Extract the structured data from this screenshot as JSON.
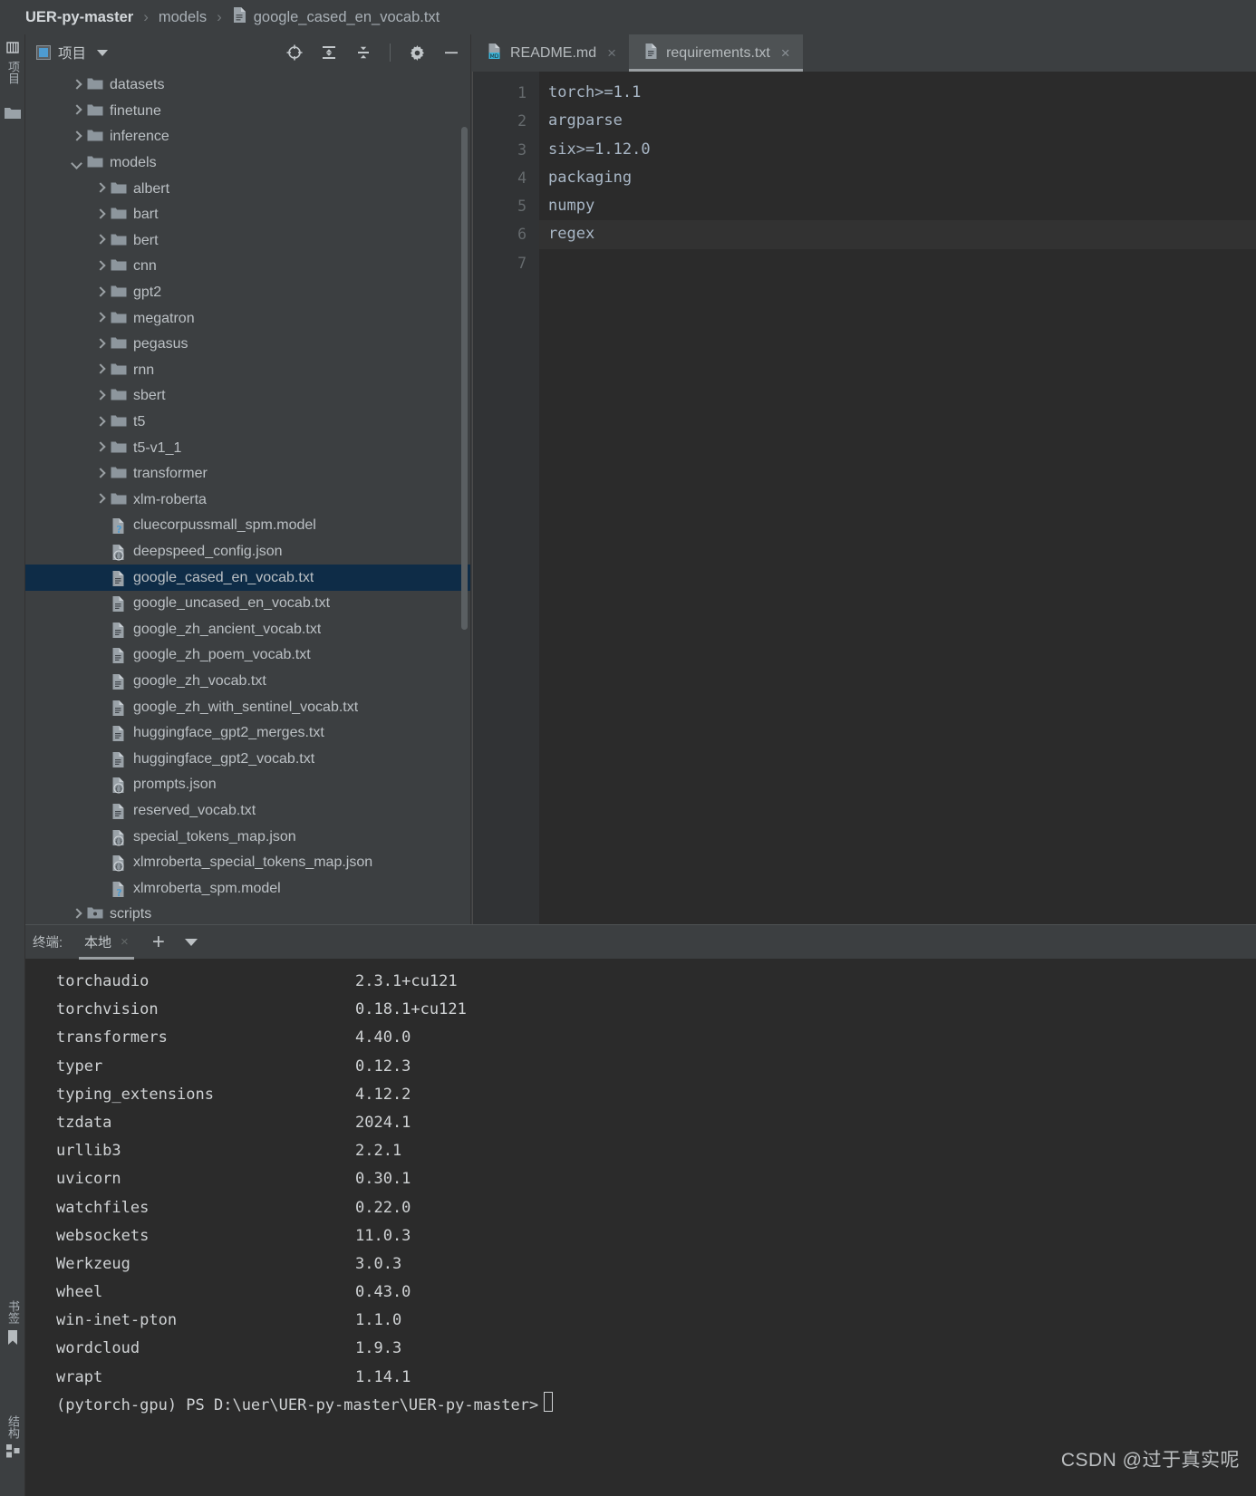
{
  "breadcrumb": {
    "root": "UER-py-master",
    "sep": "›",
    "middle": "models",
    "file": "google_cased_en_vocab.txt",
    "file_icon": "txt-file-icon"
  },
  "left_bar": {
    "top": [
      {
        "label": "项目",
        "icon": "project-icon"
      },
      {
        "label": "",
        "icon": "folder-icon"
      }
    ],
    "bottom": [
      {
        "label": "书签",
        "icon": "bookmark-icon"
      },
      {
        "label": "结构",
        "icon": "structure-icon"
      }
    ]
  },
  "project_panel": {
    "title": "项目",
    "title_icon": "project-window-icon",
    "caret_icon": "chevron-down-icon",
    "tools": [
      {
        "name": "locate-icon",
        "title": "Select Opened File"
      },
      {
        "name": "expand-all-icon",
        "title": "Expand All"
      },
      {
        "name": "collapse-all-icon",
        "title": "Collapse All"
      },
      {
        "name": "gear-icon",
        "title": "Settings"
      },
      {
        "name": "minimize-icon",
        "title": "Hide"
      }
    ],
    "tree": [
      {
        "label": "datasets",
        "indent": 1,
        "arrow": "closed",
        "icon": "folder",
        "selected": false
      },
      {
        "label": "finetune",
        "indent": 1,
        "arrow": "closed",
        "icon": "folder",
        "selected": false
      },
      {
        "label": "inference",
        "indent": 1,
        "arrow": "closed",
        "icon": "folder",
        "selected": false
      },
      {
        "label": "models",
        "indent": 1,
        "arrow": "open",
        "icon": "folder",
        "selected": false
      },
      {
        "label": "albert",
        "indent": 2,
        "arrow": "closed",
        "icon": "folder",
        "selected": false
      },
      {
        "label": "bart",
        "indent": 2,
        "arrow": "closed",
        "icon": "folder",
        "selected": false
      },
      {
        "label": "bert",
        "indent": 2,
        "arrow": "closed",
        "icon": "folder",
        "selected": false
      },
      {
        "label": "cnn",
        "indent": 2,
        "arrow": "closed",
        "icon": "folder",
        "selected": false
      },
      {
        "label": "gpt2",
        "indent": 2,
        "arrow": "closed",
        "icon": "folder",
        "selected": false
      },
      {
        "label": "megatron",
        "indent": 2,
        "arrow": "closed",
        "icon": "folder",
        "selected": false
      },
      {
        "label": "pegasus",
        "indent": 2,
        "arrow": "closed",
        "icon": "folder",
        "selected": false
      },
      {
        "label": "rnn",
        "indent": 2,
        "arrow": "closed",
        "icon": "folder",
        "selected": false
      },
      {
        "label": "sbert",
        "indent": 2,
        "arrow": "closed",
        "icon": "folder",
        "selected": false
      },
      {
        "label": "t5",
        "indent": 2,
        "arrow": "closed",
        "icon": "folder",
        "selected": false
      },
      {
        "label": "t5-v1_1",
        "indent": 2,
        "arrow": "closed",
        "icon": "folder",
        "selected": false
      },
      {
        "label": "transformer",
        "indent": 2,
        "arrow": "closed",
        "icon": "folder",
        "selected": false
      },
      {
        "label": "xlm-roberta",
        "indent": 2,
        "arrow": "closed",
        "icon": "folder",
        "selected": false
      },
      {
        "label": "cluecorpussmall_spm.model",
        "indent": 2,
        "arrow": "none",
        "icon": "unknown-file",
        "selected": false
      },
      {
        "label": "deepspeed_config.json",
        "indent": 2,
        "arrow": "none",
        "icon": "json-file",
        "selected": false
      },
      {
        "label": "google_cased_en_vocab.txt",
        "indent": 2,
        "arrow": "none",
        "icon": "txt-file",
        "selected": true
      },
      {
        "label": "google_uncased_en_vocab.txt",
        "indent": 2,
        "arrow": "none",
        "icon": "txt-file",
        "selected": false
      },
      {
        "label": "google_zh_ancient_vocab.txt",
        "indent": 2,
        "arrow": "none",
        "icon": "txt-file",
        "selected": false
      },
      {
        "label": "google_zh_poem_vocab.txt",
        "indent": 2,
        "arrow": "none",
        "icon": "txt-file",
        "selected": false
      },
      {
        "label": "google_zh_vocab.txt",
        "indent": 2,
        "arrow": "none",
        "icon": "txt-file",
        "selected": false
      },
      {
        "label": "google_zh_with_sentinel_vocab.txt",
        "indent": 2,
        "arrow": "none",
        "icon": "txt-file",
        "selected": false
      },
      {
        "label": "huggingface_gpt2_merges.txt",
        "indent": 2,
        "arrow": "none",
        "icon": "txt-file",
        "selected": false
      },
      {
        "label": "huggingface_gpt2_vocab.txt",
        "indent": 2,
        "arrow": "none",
        "icon": "txt-file",
        "selected": false
      },
      {
        "label": "prompts.json",
        "indent": 2,
        "arrow": "none",
        "icon": "json-file",
        "selected": false
      },
      {
        "label": "reserved_vocab.txt",
        "indent": 2,
        "arrow": "none",
        "icon": "txt-file",
        "selected": false
      },
      {
        "label": "special_tokens_map.json",
        "indent": 2,
        "arrow": "none",
        "icon": "json-file",
        "selected": false
      },
      {
        "label": "xlmroberta_special_tokens_map.json",
        "indent": 2,
        "arrow": "none",
        "icon": "json-file",
        "selected": false
      },
      {
        "label": "xlmroberta_spm.model",
        "indent": 2,
        "arrow": "none",
        "icon": "unknown-file",
        "selected": false
      },
      {
        "label": "scripts",
        "indent": 1,
        "arrow": "closed",
        "icon": "source-folder",
        "selected": false
      }
    ]
  },
  "editor": {
    "tabs": [
      {
        "label": "README.md",
        "icon": "md-file-icon",
        "active": false,
        "close": "×"
      },
      {
        "label": "requirements.txt",
        "icon": "txt-file-icon",
        "active": true,
        "close": "×"
      }
    ],
    "line_numbers": [
      "1",
      "2",
      "3",
      "4",
      "5",
      "6",
      "7"
    ],
    "lines": [
      {
        "text": "torch>=1.1",
        "current": false
      },
      {
        "text": "argparse",
        "current": false
      },
      {
        "text": "six>=1.12.0",
        "current": false
      },
      {
        "text": "packaging",
        "current": false
      },
      {
        "text": "numpy",
        "current": false
      },
      {
        "text": "regex",
        "current": true
      },
      {
        "text": "",
        "current": false
      }
    ]
  },
  "terminal": {
    "label": "终端:",
    "tab": "本地",
    "tab_close": "×",
    "add_icon": "plus-icon",
    "dropdown_icon": "chevron-down-icon",
    "packages": [
      {
        "name": "torchaudio",
        "version": "2.3.1+cu121"
      },
      {
        "name": "torchvision",
        "version": "0.18.1+cu121"
      },
      {
        "name": "transformers",
        "version": "4.40.0"
      },
      {
        "name": "typer",
        "version": "0.12.3"
      },
      {
        "name": "typing_extensions",
        "version": "4.12.2"
      },
      {
        "name": "tzdata",
        "version": "2024.1"
      },
      {
        "name": "urllib3",
        "version": "2.2.1"
      },
      {
        "name": "uvicorn",
        "version": "0.30.1"
      },
      {
        "name": "watchfiles",
        "version": "0.22.0"
      },
      {
        "name": "websockets",
        "version": "11.0.3"
      },
      {
        "name": "Werkzeug",
        "version": "3.0.3"
      },
      {
        "name": "wheel",
        "version": "0.43.0"
      },
      {
        "name": "win-inet-pton",
        "version": "1.1.0"
      },
      {
        "name": "wordcloud",
        "version": "1.9.3"
      },
      {
        "name": "wrapt",
        "version": "1.14.1"
      }
    ],
    "prompt": "(pytorch-gpu) PS D:\\uer\\UER-py-master\\UER-py-master>"
  },
  "watermark": "CSDN @过于真实呢",
  "colors": {
    "panel_bg": "#3c3f41",
    "editor_bg": "#2b2b2b",
    "selection": "#0e2c47",
    "text": "#bbc0c4",
    "accent": "#4e9bd0"
  }
}
